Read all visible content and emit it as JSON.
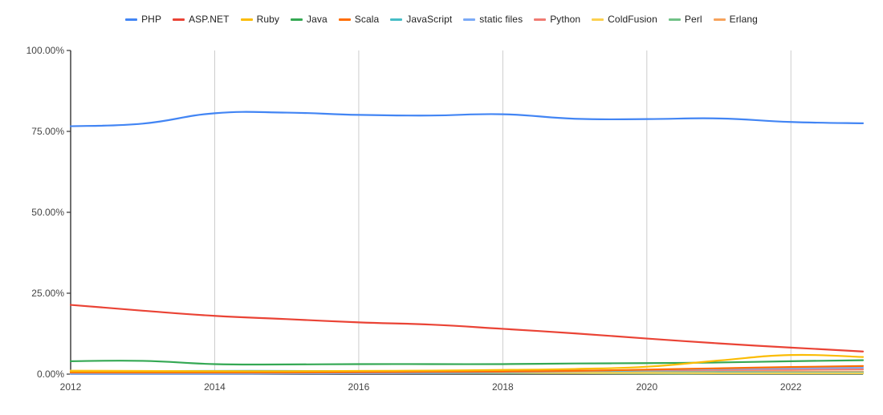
{
  "chart_data": {
    "type": "line",
    "title": "",
    "subtitle": "",
    "xlabel": "",
    "ylabel": "",
    "grid": true,
    "legend_position": "top",
    "xlim": [
      2012,
      2023
    ],
    "ylim": [
      0,
      100
    ],
    "y_ticks": [
      "0.00%",
      "25.00%",
      "50.00%",
      "75.00%",
      "100.00%"
    ],
    "y_tick_values": [
      0,
      25,
      50,
      75,
      100
    ],
    "x_ticks": [
      "2012",
      "2014",
      "2016",
      "2018",
      "2020",
      "2022"
    ],
    "x_tick_values": [
      2012,
      2014,
      2016,
      2018,
      2020,
      2022
    ],
    "x": [
      2012,
      2013,
      2014,
      2015,
      2016,
      2017,
      2018,
      2019,
      2020,
      2021,
      2022,
      2023
    ],
    "series": [
      {
        "name": "PHP",
        "color": "#4285f4",
        "values": [
          76.6,
          77.4,
          80.6,
          80.8,
          80.1,
          79.9,
          80.3,
          78.9,
          78.8,
          79.0,
          77.9,
          77.5
        ]
      },
      {
        "name": "ASP.NET",
        "color": "#ea4335",
        "values": [
          21.4,
          19.6,
          18.0,
          17.0,
          16.0,
          15.3,
          14.0,
          12.6,
          11.0,
          9.5,
          8.2,
          7.0
        ]
      },
      {
        "name": "Ruby",
        "color": "#fbbc04",
        "values": [
          0.9,
          0.9,
          0.9,
          0.9,
          1.0,
          1.1,
          1.3,
          1.6,
          2.3,
          4.2,
          5.9,
          5.3
        ]
      },
      {
        "name": "Java",
        "color": "#34a853",
        "values": [
          4.0,
          4.1,
          3.1,
          3.0,
          3.1,
          3.1,
          3.1,
          3.3,
          3.4,
          3.6,
          4.0,
          4.3
        ]
      },
      {
        "name": "Scala",
        "color": "#ff6d01",
        "values": [
          0.5,
          0.5,
          0.5,
          0.5,
          0.6,
          0.7,
          0.8,
          1.0,
          1.4,
          1.8,
          2.2,
          2.5
        ]
      },
      {
        "name": "JavaScript",
        "color": "#46bdc6",
        "values": [
          0.8,
          0.9,
          1.0,
          1.0,
          0.9,
          0.8,
          0.7,
          0.7,
          0.6,
          0.6,
          0.5,
          0.5
        ]
      },
      {
        "name": "static files",
        "color": "#7baaf7",
        "values": [
          0.1,
          0.1,
          0.1,
          0.2,
          0.3,
          0.4,
          0.6,
          0.9,
          1.3,
          1.6,
          1.8,
          2.0
        ]
      },
      {
        "name": "Python",
        "color": "#f07b72",
        "values": [
          0.8,
          0.8,
          0.8,
          0.8,
          0.9,
          0.9,
          1.0,
          1.1,
          1.2,
          1.3,
          1.4,
          1.5
        ]
      },
      {
        "name": "ColdFusion",
        "color": "#fcd04f",
        "values": [
          1.1,
          1.0,
          0.9,
          0.8,
          0.7,
          0.6,
          0.5,
          0.4,
          0.4,
          0.3,
          0.3,
          0.3
        ]
      },
      {
        "name": "Perl",
        "color": "#71c287",
        "values": [
          0.6,
          0.5,
          0.5,
          0.4,
          0.4,
          0.3,
          0.3,
          0.3,
          0.2,
          0.2,
          0.2,
          0.2
        ]
      },
      {
        "name": "Erlang",
        "color": "#f7a35c",
        "values": [
          0.2,
          0.2,
          0.2,
          0.3,
          0.3,
          0.4,
          0.5,
          0.6,
          0.7,
          0.8,
          0.8,
          0.8
        ]
      }
    ]
  },
  "axis": {
    "axis_color": "#333333",
    "grid_color": "#cccccc",
    "tick_text_color": "#444444"
  }
}
